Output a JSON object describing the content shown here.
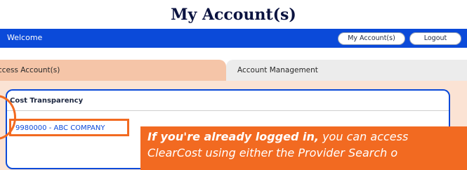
{
  "page_title": "My Account(s)",
  "topbar": {
    "welcome": "Welcome",
    "my_accounts_label": "My Account(s)",
    "logout_label": "Logout"
  },
  "tabs": [
    {
      "label": "ccess Account(s)",
      "active": true
    },
    {
      "label": "Account Management",
      "active": false
    }
  ],
  "card": {
    "title": "Cost Transparency",
    "account": "9980000 - ABC COMPANY"
  },
  "callout": {
    "bold_text": "If you're already logged in,",
    "line1_rest": " you can access",
    "line2": "ClearCost using either the Provider Search o"
  },
  "colors": {
    "brand_blue": "#0b4ad9",
    "highlight_orange": "#f26a21",
    "active_tab": "#f5c5a8",
    "panel_bg": "#fbe3d4"
  }
}
